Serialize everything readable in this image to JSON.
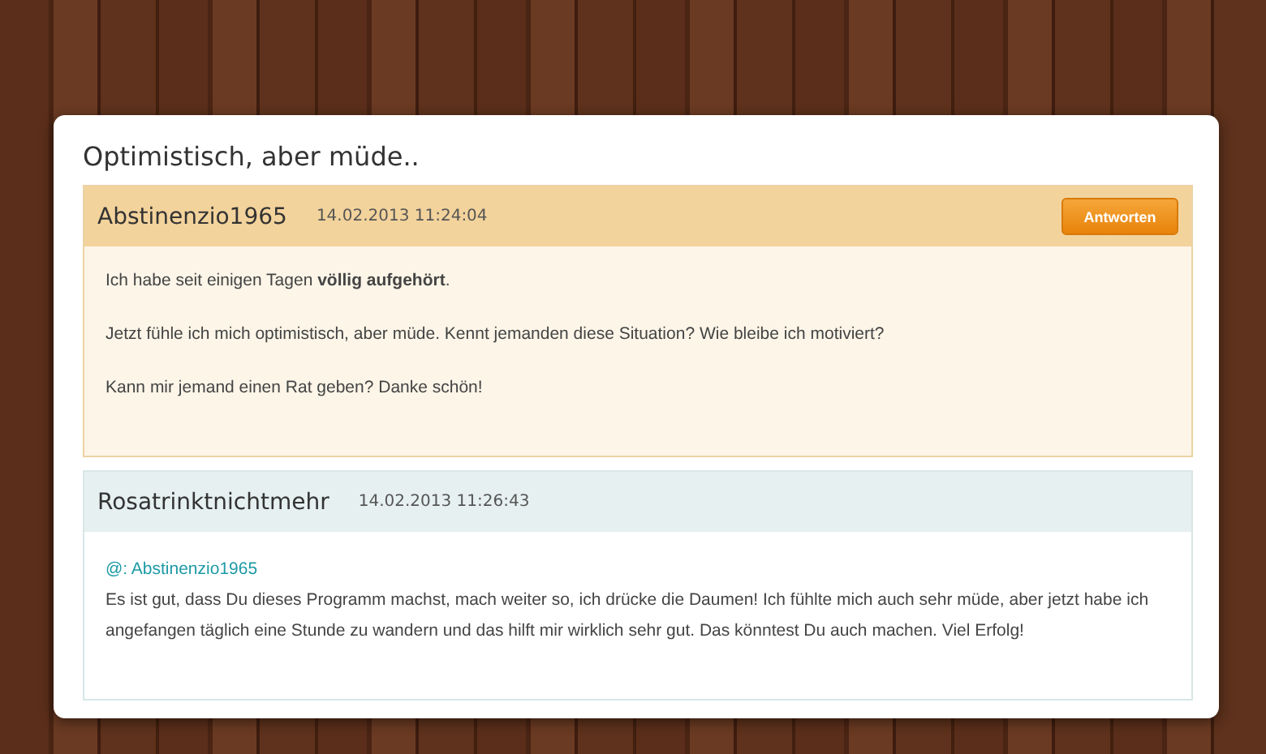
{
  "thread": {
    "title": "Optimistisch, aber müde..",
    "posts": [
      {
        "kind": "original",
        "author": "Abstinenzio1965",
        "timestamp": "14.02.2013 11:24:04",
        "reply_button": "Antworten",
        "paragraphs": [
          "Ich habe seit einigen Tagen **völlig aufgehört**.",
          "Jetzt fühle ich mich optimistisch, aber müde. Kennt jemanden diese Situation? Wie bleibe ich motiviert?",
          "Kann mir jemand einen Rat geben? Danke schön!"
        ]
      },
      {
        "kind": "reply",
        "author": "Rosatrinktnichtmehr",
        "timestamp": "14.02.2013 11:26:43",
        "mention": "@: Abstinenzio1965",
        "paragraphs": [
          "Es ist gut, dass Du dieses Programm machst, mach weiter so, ich drücke die Daumen! Ich fühlte mich auch sehr müde, aber jetzt habe ich angefangen täglich eine Stunde zu wandern und das hilft mir wirklich sehr gut. Das könntest Du auch machen. Viel Erfolg!"
        ]
      }
    ]
  }
}
